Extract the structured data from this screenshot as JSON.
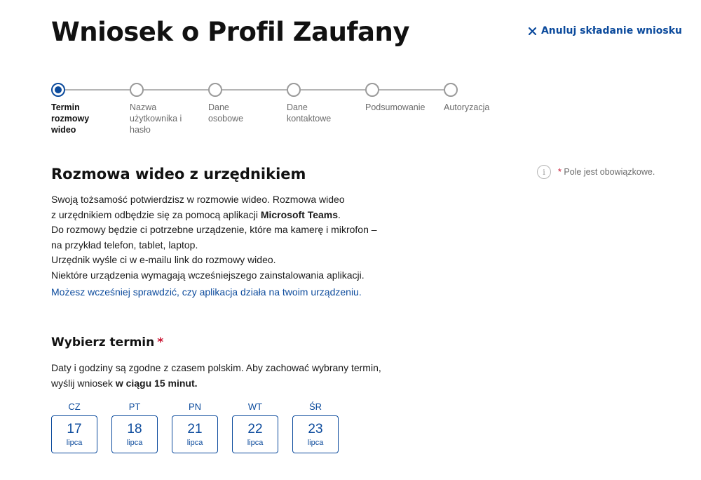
{
  "header": {
    "title": "Wniosek o Profil Zaufany",
    "cancel_label": "Anuluj składanie wniosku",
    "cancel_icon": "close-icon"
  },
  "colors": {
    "accent": "#0b4a9c",
    "required": "#c8102e",
    "muted": "#6b6b6b"
  },
  "stepper": {
    "steps": [
      {
        "label": "Termin rozmowy wideo",
        "state": "active"
      },
      {
        "label": "Nazwa użytkownika i hasło",
        "state": "pending"
      },
      {
        "label": "Dane osobowe",
        "state": "pending"
      },
      {
        "label": "Dane kontaktowe",
        "state": "pending"
      },
      {
        "label": "Podsumowanie",
        "state": "pending"
      },
      {
        "label": "Autoryzacja",
        "state": "pending"
      }
    ]
  },
  "required_note": {
    "icon": "info-icon",
    "asterisk": "*",
    "text": "Pole jest obowiązkowe."
  },
  "video_section": {
    "title": "Rozmowa wideo z urzędnikiem",
    "line1": "Swoją tożsamość potwierdzisz w rozmowie wideo. Rozmowa wideo",
    "line2_prefix": "z urzędnikiem odbędzie się za pomocą aplikacji ",
    "line2_bold": "Microsoft Teams",
    "line2_suffix": ".",
    "line3": "Do rozmowy będzie ci potrzebne urządzenie, które ma kamerę i mikrofon –",
    "line4": "na przykład telefon, tablet, laptop.",
    "line5": "Urzędnik wyśle ci w e-mailu link do rozmowy wideo.",
    "line6": "Niektóre urządzenia wymagają wcześniejszego zainstalowania aplikacji.",
    "check_link": "Możesz wcześniej sprawdzić, czy aplikacja działa na twoim urządzeniu."
  },
  "term_section": {
    "title": "Wybierz termin",
    "asterisk": "*",
    "note_line1": "Daty i godziny są zgodne z czasem polskim. Aby zachować wybrany termin,",
    "note_line2_prefix": "wyślij wniosek ",
    "note_line2_bold": "w ciągu 15 minut."
  },
  "dates": [
    {
      "dow": "CZ",
      "day": "17",
      "month": "lipca"
    },
    {
      "dow": "PT",
      "day": "18",
      "month": "lipca"
    },
    {
      "dow": "PN",
      "day": "21",
      "month": "lipca"
    },
    {
      "dow": "WT",
      "day": "22",
      "month": "lipca"
    },
    {
      "dow": "ŚR",
      "day": "23",
      "month": "lipca"
    }
  ]
}
